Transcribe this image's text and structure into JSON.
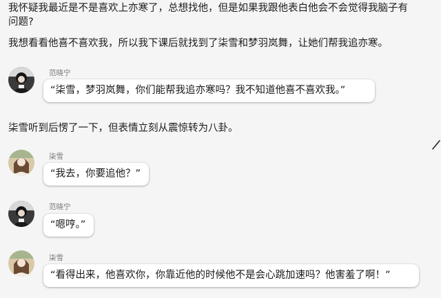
{
  "narration": [
    "我怀疑我最近是不是喜欢上亦寒了，总想找他，但是如果我跟他表白他会不会觉得我脑子有",
    "问题?",
    "我想看看他喜不喜欢我，所以我下课后就找到了柒雪和梦羽岚舞，让她们帮我追亦寒。",
    "柒雪听到后愣了一下，但表情立刻从震惊转为八卦。"
  ],
  "messages": [
    {
      "speaker": "范晓宁",
      "text": "“柒雪，梦羽岚舞，你们能帮我追亦寒吗？我不知道他喜不喜欢我。”",
      "avatar": "dark-portrait-avatar"
    },
    {
      "speaker": "柒雪",
      "text": "“我去，你要追他？”",
      "avatar": "light-portrait-avatar"
    },
    {
      "speaker": "范晓宁",
      "text": "“嗯哼。”",
      "avatar": "dark-portrait-avatar"
    },
    {
      "speaker": "柒雪",
      "text": "“看得出来，他喜欢你，你靠近他的时候他不是会心跳加速吗？他害羞了啊！”",
      "avatar": "light-portrait-avatar"
    }
  ],
  "colors": {
    "background": "#f5f5f5",
    "bubble": "#ffffff",
    "speaker_text": "#7a7a7a"
  }
}
